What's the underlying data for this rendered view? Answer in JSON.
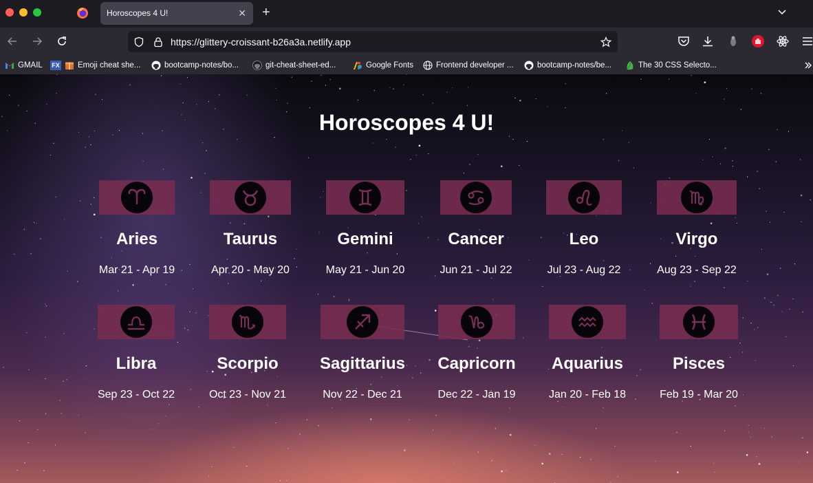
{
  "browser": {
    "tab_title": "Horoscopes 4 U!",
    "url": "https://glittery-croissant-b26a3a.netlify.app",
    "bookmarks": [
      {
        "label": "GMAIL",
        "icon": "gmail-icon"
      },
      {
        "label": "Emoji cheat she...",
        "icon": "emoji-icon"
      },
      {
        "label": "bootcamp-notes/bo...",
        "icon": "github-icon"
      },
      {
        "label": "git-cheat-sheet-ed...",
        "icon": "github-icon"
      },
      {
        "label": "Google Fonts",
        "icon": "google-fonts-icon"
      },
      {
        "label": "Frontend developer ...",
        "icon": "globe-icon"
      },
      {
        "label": "bootcamp-notes/be...",
        "icon": "github-icon"
      },
      {
        "label": "The 30 CSS Selecto...",
        "icon": "leaf-icon"
      }
    ]
  },
  "page": {
    "title": "Horoscopes 4 U!"
  },
  "signs": [
    {
      "name": "Aries",
      "dates": "Mar 21 - Apr 19",
      "icon": "aries-icon"
    },
    {
      "name": "Taurus",
      "dates": "Apr 20 - May 20",
      "icon": "taurus-icon"
    },
    {
      "name": "Gemini",
      "dates": "May 21 - Jun 20",
      "icon": "gemini-icon"
    },
    {
      "name": "Cancer",
      "dates": "Jun 21 - Jul 22",
      "icon": "cancer-icon"
    },
    {
      "name": "Leo",
      "dates": "Jul 23 - Aug 22",
      "icon": "leo-icon"
    },
    {
      "name": "Virgo",
      "dates": "Aug 23 - Sep 22",
      "icon": "virgo-icon"
    },
    {
      "name": "Libra",
      "dates": "Sep 23 - Oct 22",
      "icon": "libra-icon"
    },
    {
      "name": "Scorpio",
      "dates": "Oct 23 - Nov 21",
      "icon": "scorpio-icon"
    },
    {
      "name": "Sagittarius",
      "dates": "Nov 22 - Dec 21",
      "icon": "sagittarius-icon"
    },
    {
      "name": "Capricorn",
      "dates": "Dec 22 - Jan 19",
      "icon": "capricorn-icon"
    },
    {
      "name": "Aquarius",
      "dates": "Jan 20 - Feb 18",
      "icon": "aquarius-icon"
    },
    {
      "name": "Pisces",
      "dates": "Feb 19 - Mar 20",
      "icon": "pisces-icon"
    }
  ]
}
